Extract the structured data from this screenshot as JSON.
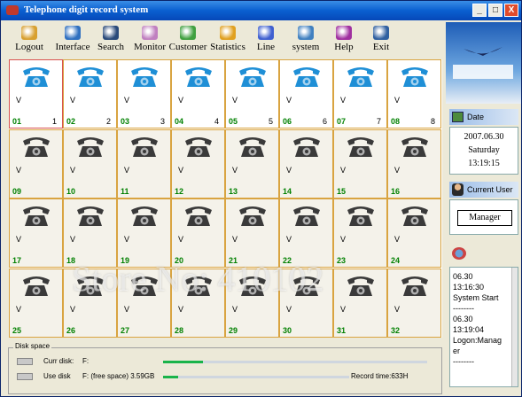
{
  "window": {
    "title": "Telephone digit record system",
    "minimize_label": "_",
    "maximize_label": "□",
    "close_label": "X"
  },
  "toolbar": {
    "items": [
      {
        "label": "Logout",
        "icon": "logout-icon"
      },
      {
        "label": "Interface",
        "icon": "interface-icon"
      },
      {
        "label": "Search",
        "icon": "search-icon"
      },
      {
        "label": "Monitor",
        "icon": "monitor-icon"
      },
      {
        "label": "Customer",
        "icon": "customer-icon"
      },
      {
        "label": "Statistics",
        "icon": "statistics-icon"
      },
      {
        "label": "Line",
        "icon": "line-icon"
      },
      {
        "label": "system",
        "icon": "system-icon"
      },
      {
        "label": "Help",
        "icon": "help-icon"
      },
      {
        "label": "Exit",
        "icon": "exit-icon"
      }
    ]
  },
  "lines": [
    {
      "num": "01",
      "idx": "1",
      "v": "V",
      "active": true
    },
    {
      "num": "02",
      "idx": "2",
      "v": "V",
      "active": true
    },
    {
      "num": "03",
      "idx": "3",
      "v": "V",
      "active": true
    },
    {
      "num": "04",
      "idx": "4",
      "v": "V",
      "active": true
    },
    {
      "num": "05",
      "idx": "5",
      "v": "V",
      "active": true
    },
    {
      "num": "06",
      "idx": "6",
      "v": "V",
      "active": true
    },
    {
      "num": "07",
      "idx": "7",
      "v": "V",
      "active": true
    },
    {
      "num": "08",
      "idx": "8",
      "v": "V",
      "active": true
    },
    {
      "num": "09",
      "idx": "",
      "v": "V",
      "active": false
    },
    {
      "num": "10",
      "idx": "",
      "v": "V",
      "active": false
    },
    {
      "num": "11",
      "idx": "",
      "v": "V",
      "active": false
    },
    {
      "num": "12",
      "idx": "",
      "v": "V",
      "active": false
    },
    {
      "num": "13",
      "idx": "",
      "v": "V",
      "active": false
    },
    {
      "num": "14",
      "idx": "",
      "v": "V",
      "active": false
    },
    {
      "num": "15",
      "idx": "",
      "v": "V",
      "active": false
    },
    {
      "num": "16",
      "idx": "",
      "v": "V",
      "active": false
    },
    {
      "num": "17",
      "idx": "",
      "v": "V",
      "active": false
    },
    {
      "num": "18",
      "idx": "",
      "v": "V",
      "active": false
    },
    {
      "num": "19",
      "idx": "",
      "v": "V",
      "active": false
    },
    {
      "num": "20",
      "idx": "",
      "v": "V",
      "active": false
    },
    {
      "num": "21",
      "idx": "",
      "v": "V",
      "active": false
    },
    {
      "num": "22",
      "idx": "",
      "v": "V",
      "active": false
    },
    {
      "num": "23",
      "idx": "",
      "v": "V",
      "active": false
    },
    {
      "num": "24",
      "idx": "",
      "v": "V",
      "active": false
    },
    {
      "num": "25",
      "idx": "",
      "v": "V",
      "active": false
    },
    {
      "num": "26",
      "idx": "",
      "v": "V",
      "active": false
    },
    {
      "num": "27",
      "idx": "",
      "v": "V",
      "active": false
    },
    {
      "num": "28",
      "idx": "",
      "v": "V",
      "active": false
    },
    {
      "num": "29",
      "idx": "",
      "v": "V",
      "active": false
    },
    {
      "num": "30",
      "idx": "",
      "v": "V",
      "active": false
    },
    {
      "num": "31",
      "idx": "",
      "v": "V",
      "active": false
    },
    {
      "num": "32",
      "idx": "",
      "v": "V",
      "active": false
    }
  ],
  "side": {
    "date_title": "Date",
    "date": "2007.06.30",
    "weekday": "Saturday",
    "time": "13:19:15",
    "user_title": "Current User",
    "user": "Manager",
    "log": [
      "06.30",
      "13:16:30",
      "System Start",
      "--------",
      "06.30",
      "13:19:04",
      "Logon:Manag",
      "er",
      "--------"
    ]
  },
  "disk": {
    "title": "Disk space",
    "curr_label": "Curr disk:",
    "curr_value": "F:",
    "use_label": "Use disk",
    "use_value": "F: (free space)  3.59GB",
    "record_time": "Record time:633H",
    "curr_progress": 0.15,
    "use_progress": 0.08
  },
  "watermark": "Store No: 410102",
  "colors": {
    "active_phone": "#1f8fd6",
    "idle_phone": "#3a3a3a",
    "line_number": "#008000",
    "cell_border": "#d9a441",
    "progress_fill": "#19b34a"
  }
}
